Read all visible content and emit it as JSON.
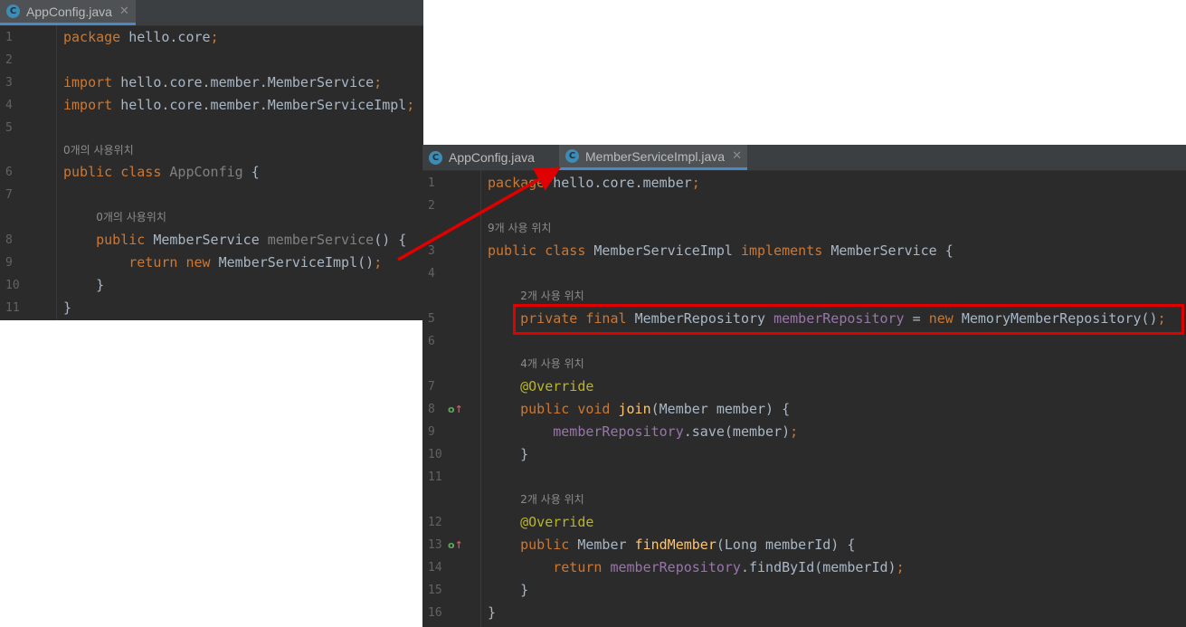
{
  "left_editor": {
    "tab": {
      "title": "AppConfig.java",
      "icon": "class-c-icon"
    },
    "lines": [
      {
        "n": "1",
        "tokens": [
          [
            "kw",
            "package"
          ],
          [
            "t",
            " hello.core"
          ],
          [
            "kw",
            ";"
          ]
        ]
      },
      {
        "n": "2",
        "tokens": []
      },
      {
        "n": "3",
        "tokens": [
          [
            "kw",
            "import"
          ],
          [
            "t",
            " hello.core.member.MemberService"
          ],
          [
            "kw",
            ";"
          ]
        ]
      },
      {
        "n": "4",
        "tokens": [
          [
            "kw",
            "import"
          ],
          [
            "t",
            " hello.core.member.MemberServiceImpl"
          ],
          [
            "kw",
            ";"
          ]
        ]
      },
      {
        "n": "5",
        "tokens": []
      },
      {
        "n": "",
        "hint": "0개의 사용위치"
      },
      {
        "n": "6",
        "tokens": [
          [
            "kw",
            "public class "
          ],
          [
            "gray",
            "AppConfig"
          ],
          [
            "t",
            " {"
          ]
        ]
      },
      {
        "n": "7",
        "tokens": []
      },
      {
        "n": "",
        "hint": "0개의 사용위치",
        "indent": 4
      },
      {
        "n": "8",
        "tokens": [
          [
            "t",
            "    "
          ],
          [
            "kw",
            "public "
          ],
          [
            "t",
            "MemberService "
          ],
          [
            "gray",
            "memberService"
          ],
          [
            "t",
            "() {"
          ]
        ]
      },
      {
        "n": "9",
        "tokens": [
          [
            "t",
            "        "
          ],
          [
            "kw",
            "return new "
          ],
          [
            "t",
            "MemberServiceImpl()"
          ],
          [
            "kw",
            ";"
          ]
        ]
      },
      {
        "n": "10",
        "tokens": [
          [
            "t",
            "    }"
          ]
        ]
      },
      {
        "n": "11",
        "tokens": [
          [
            "t",
            "}"
          ]
        ]
      }
    ]
  },
  "right_editor": {
    "tabs": [
      {
        "title": "AppConfig.java",
        "icon": "class-c-icon",
        "active": false
      },
      {
        "title": "MemberServiceImpl.java",
        "icon": "class-c-icon",
        "active": true
      }
    ],
    "lines": [
      {
        "n": "1",
        "tokens": [
          [
            "kw",
            "package"
          ],
          [
            "t",
            " hello.core.member"
          ],
          [
            "kw",
            ";"
          ]
        ]
      },
      {
        "n": "2",
        "tokens": []
      },
      {
        "n": "",
        "hint": "9개 사용 위치"
      },
      {
        "n": "3",
        "tokens": [
          [
            "kw",
            "public class "
          ],
          [
            "t",
            "MemberServiceImpl "
          ],
          [
            "kw",
            "implements "
          ],
          [
            "t",
            "MemberService {"
          ]
        ]
      },
      {
        "n": "4",
        "tokens": []
      },
      {
        "n": "",
        "hint": "2개 사용 위치",
        "indent": 4
      },
      {
        "n": "5",
        "tokens": [
          [
            "t",
            "    "
          ],
          [
            "kw",
            "private final "
          ],
          [
            "t",
            "MemberRepository "
          ],
          [
            "fld",
            "memberRepository"
          ],
          [
            "t",
            " = "
          ],
          [
            "kw",
            "new "
          ],
          [
            "t",
            "MemoryMemberRepository()"
          ],
          [
            "kw",
            ";"
          ]
        ]
      },
      {
        "n": "6",
        "tokens": []
      },
      {
        "n": "",
        "hint": "4개 사용 위치",
        "indent": 4
      },
      {
        "n": "7",
        "tokens": [
          [
            "t",
            "    "
          ],
          [
            "ann",
            "@Override"
          ]
        ]
      },
      {
        "n": "8",
        "tokens": [
          [
            "t",
            "    "
          ],
          [
            "kw",
            "public void "
          ],
          [
            "fn",
            "join"
          ],
          [
            "t",
            "(Member member) {"
          ]
        ]
      },
      {
        "n": "9",
        "tokens": [
          [
            "t",
            "        "
          ],
          [
            "fld",
            "memberRepository"
          ],
          [
            "t",
            ".save(member)"
          ],
          [
            "kw",
            ";"
          ]
        ]
      },
      {
        "n": "10",
        "tokens": [
          [
            "t",
            "    }"
          ]
        ]
      },
      {
        "n": "11",
        "tokens": []
      },
      {
        "n": "",
        "hint": "2개 사용 위치",
        "indent": 4
      },
      {
        "n": "12",
        "tokens": [
          [
            "t",
            "    "
          ],
          [
            "ann",
            "@Override"
          ]
        ]
      },
      {
        "n": "13",
        "tokens": [
          [
            "t",
            "    "
          ],
          [
            "kw",
            "public "
          ],
          [
            "t",
            "Member "
          ],
          [
            "fn",
            "findMember"
          ],
          [
            "t",
            "(Long memberId) {"
          ]
        ]
      },
      {
        "n": "14",
        "tokens": [
          [
            "t",
            "        "
          ],
          [
            "kw",
            "return "
          ],
          [
            "fld",
            "memberRepository"
          ],
          [
            "t",
            ".findById(memberId)"
          ],
          [
            "kw",
            ";"
          ]
        ]
      },
      {
        "n": "15",
        "tokens": [
          [
            "t",
            "    }"
          ]
        ]
      },
      {
        "n": "16",
        "tokens": [
          [
            "t",
            "}"
          ]
        ]
      }
    ],
    "override_markers": [
      "8",
      "13"
    ]
  },
  "colors": {
    "keyword": "#cc7832",
    "field": "#9876aa",
    "method": "#ffc66d",
    "annotation": "#bbb529",
    "highlight_box": "#e00000",
    "arrow": "#e00000"
  }
}
